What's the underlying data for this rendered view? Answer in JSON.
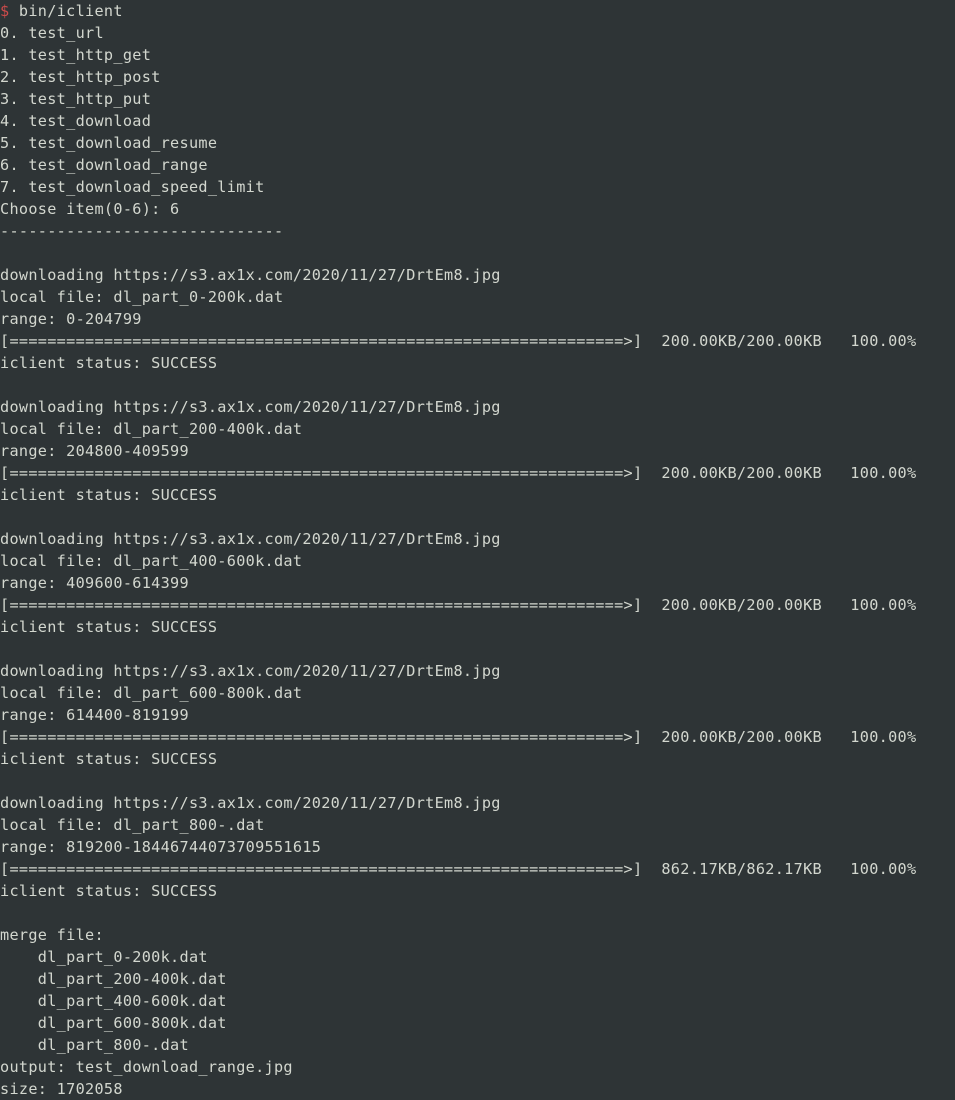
{
  "terminal": {
    "background": "#2e3436",
    "foreground": "#d3d7cf",
    "prompt_color": "#cc4b4b",
    "prompt_symbol": "$",
    "command": " bin/iclient"
  },
  "menu": {
    "items": [
      "0. test_url",
      "1. test_http_get",
      "2. test_http_post",
      "3. test_http_put",
      "4. test_download",
      "5. test_download_resume",
      "6. test_download_range",
      "7. test_download_speed_limit"
    ],
    "choose_prompt": "Choose item(0-6): 6",
    "separator": "------------------------------"
  },
  "downloads": [
    {
      "downloading": "downloading https://s3.ax1x.com/2020/11/27/DrtEm8.jpg",
      "local_file": "local file: dl_part_0-200k.dat",
      "range": "range: 0-204799",
      "bar": "[=================================================================>]",
      "stats": "  200.00KB/200.00KB   100.00%",
      "status": "iclient status: SUCCESS"
    },
    {
      "downloading": "downloading https://s3.ax1x.com/2020/11/27/DrtEm8.jpg",
      "local_file": "local file: dl_part_200-400k.dat",
      "range": "range: 204800-409599",
      "bar": "[=================================================================>]",
      "stats": "  200.00KB/200.00KB   100.00%",
      "status": "iclient status: SUCCESS"
    },
    {
      "downloading": "downloading https://s3.ax1x.com/2020/11/27/DrtEm8.jpg",
      "local_file": "local file: dl_part_400-600k.dat",
      "range": "range: 409600-614399",
      "bar": "[=================================================================>]",
      "stats": "  200.00KB/200.00KB   100.00%",
      "status": "iclient status: SUCCESS"
    },
    {
      "downloading": "downloading https://s3.ax1x.com/2020/11/27/DrtEm8.jpg",
      "local_file": "local file: dl_part_600-800k.dat",
      "range": "range: 614400-819199",
      "bar": "[=================================================================>]",
      "stats": "  200.00KB/200.00KB   100.00%",
      "status": "iclient status: SUCCESS"
    },
    {
      "downloading": "downloading https://s3.ax1x.com/2020/11/27/DrtEm8.jpg",
      "local_file": "local file: dl_part_800-.dat",
      "range": "range: 819200-18446744073709551615",
      "bar": "[=================================================================>]",
      "stats": "  862.17KB/862.17KB   100.00%",
      "status": "iclient status: SUCCESS"
    }
  ],
  "merge": {
    "header": "merge file:",
    "files": [
      "    dl_part_0-200k.dat",
      "    dl_part_200-400k.dat",
      "    dl_part_400-600k.dat",
      "    dl_part_600-800k.dat",
      "    dl_part_800-.dat"
    ],
    "output": "output: test_download_range.jpg",
    "size": "size: 1702058"
  }
}
